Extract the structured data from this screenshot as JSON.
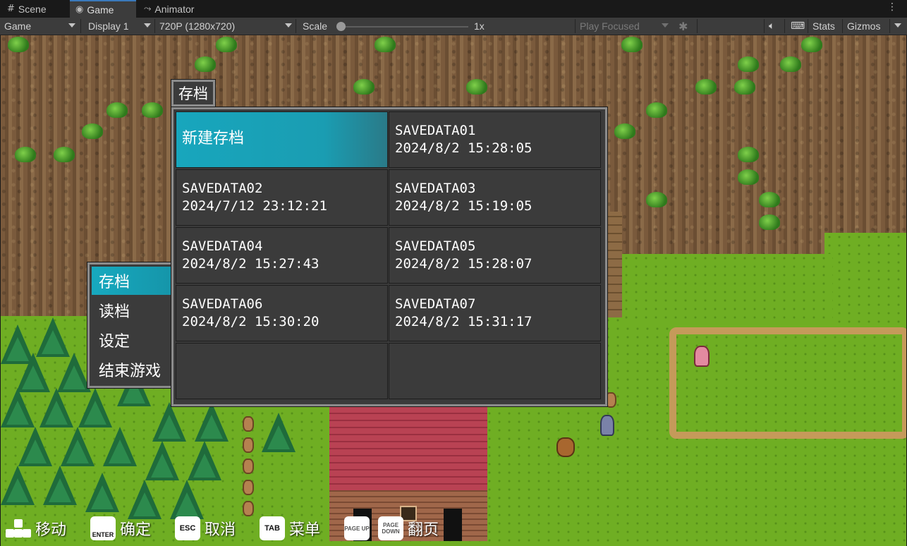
{
  "editor": {
    "tabs": [
      {
        "label": "Scene",
        "icon": "grid-icon"
      },
      {
        "label": "Game",
        "icon": "gamepad-icon"
      },
      {
        "label": "Animator",
        "icon": "animator-icon"
      }
    ],
    "toolbar": {
      "view_mode": "Game",
      "display": "Display 1",
      "resolution": "720P (1280x720)",
      "scale_label": "Scale",
      "scale_value": "1x",
      "play_mode": "Play Focused",
      "stats": "Stats",
      "gizmos": "Gizmos"
    },
    "accent_color": "#3a79bb"
  },
  "game": {
    "save_window_title": "存档",
    "main_menu": [
      {
        "label": "存档",
        "selected": true
      },
      {
        "label": "读档",
        "selected": false
      },
      {
        "label": "设定",
        "selected": false
      },
      {
        "label": "结束游戏",
        "selected": false
      }
    ],
    "save_slots": [
      {
        "name": "新建存档",
        "date": "",
        "selected": true
      },
      {
        "name": "SAVEDATA01",
        "date": "2024/8/2 15:28:05",
        "selected": false
      },
      {
        "name": "SAVEDATA02",
        "date": "2024/7/12 23:12:21",
        "selected": false
      },
      {
        "name": "SAVEDATA03",
        "date": "2024/8/2 15:19:05",
        "selected": false
      },
      {
        "name": "SAVEDATA04",
        "date": "2024/8/2 15:27:43",
        "selected": false
      },
      {
        "name": "SAVEDATA05",
        "date": "2024/8/2 15:28:07",
        "selected": false
      },
      {
        "name": "SAVEDATA06",
        "date": "2024/8/2 15:30:20",
        "selected": false
      },
      {
        "name": "SAVEDATA07",
        "date": "2024/8/2 15:31:17",
        "selected": false
      },
      {
        "name": "",
        "date": "",
        "selected": false
      },
      {
        "name": "",
        "date": "",
        "selected": false
      }
    ],
    "selection_color": "#17a9bf",
    "hints": [
      {
        "key": "",
        "key_icon": "dpad-icon",
        "label": "移动"
      },
      {
        "key": "ENTER",
        "key_icon": "enter-key-icon",
        "label": "确定"
      },
      {
        "key": "ESC",
        "key_icon": "esc-key-icon",
        "label": "取消"
      },
      {
        "key": "TAB",
        "key_icon": "tab-key-icon",
        "label": "菜单"
      },
      {
        "key": "PAGE UP",
        "key_icon": "page-up-key-icon",
        "label": ""
      },
      {
        "key": "PAGE DOWN",
        "key_icon": "page-down-key-icon",
        "label": "翻页"
      }
    ]
  }
}
